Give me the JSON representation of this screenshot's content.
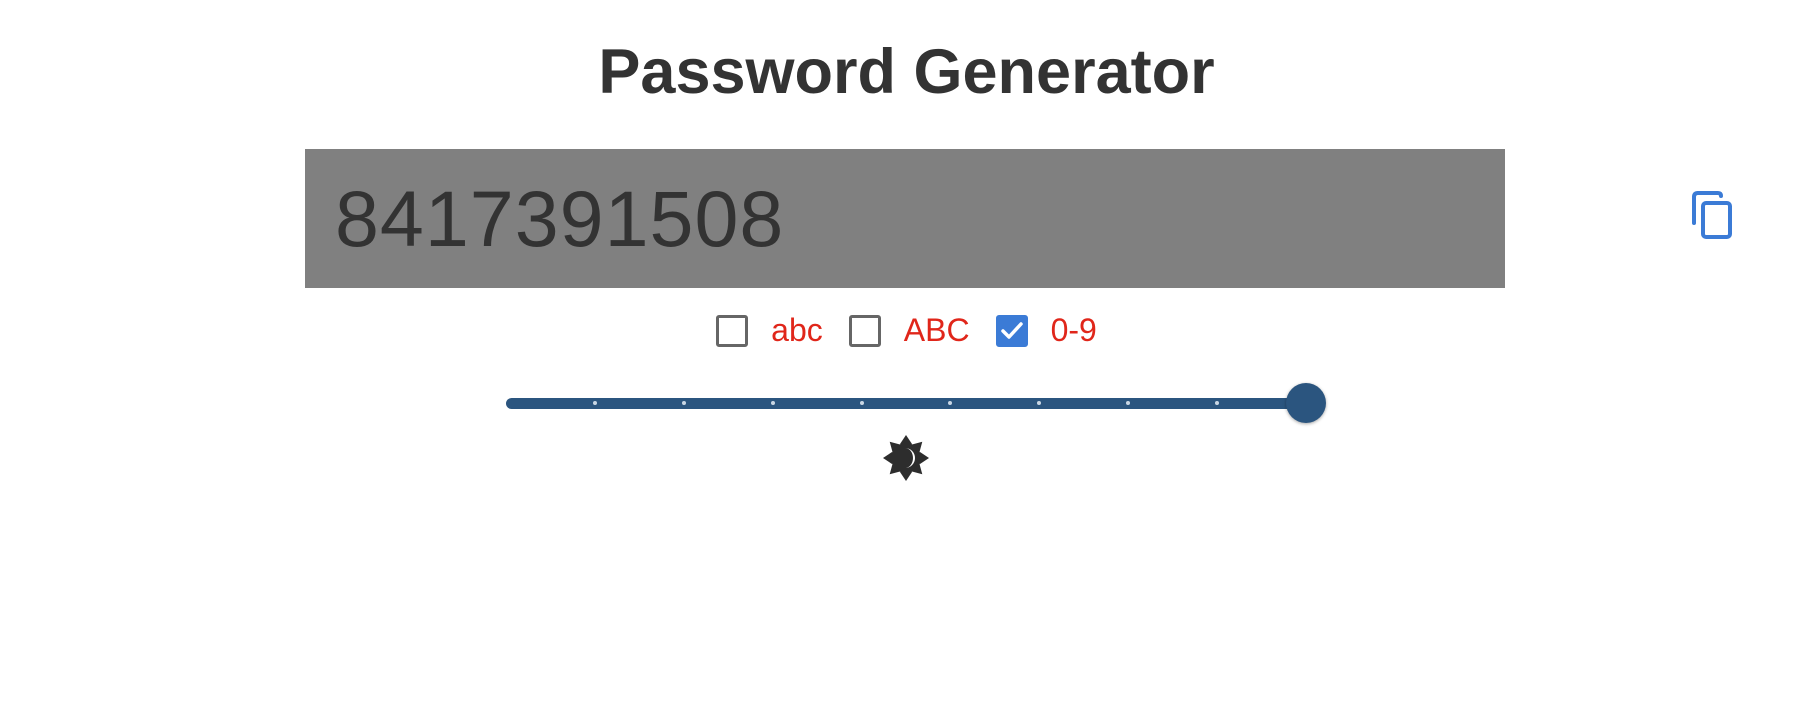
{
  "header": {
    "title": "Password Generator"
  },
  "password": {
    "value": "8417391508",
    "copy_icon": "copy-icon"
  },
  "options": [
    {
      "label": "abc",
      "checked": false
    },
    {
      "label": "ABC",
      "checked": false
    },
    {
      "label": "0-9",
      "checked": true
    }
  ],
  "length_slider": {
    "value_fraction": 1.0,
    "tick_count": 9
  },
  "theme_toggle": {
    "icon": "brightness-icon"
  },
  "colors": {
    "password_background": "#808080",
    "checkbox_checked": "#3b7bd6",
    "option_label": "#e0261a",
    "slider": "#2b557f",
    "copy_icon": "#3b7bd6"
  }
}
